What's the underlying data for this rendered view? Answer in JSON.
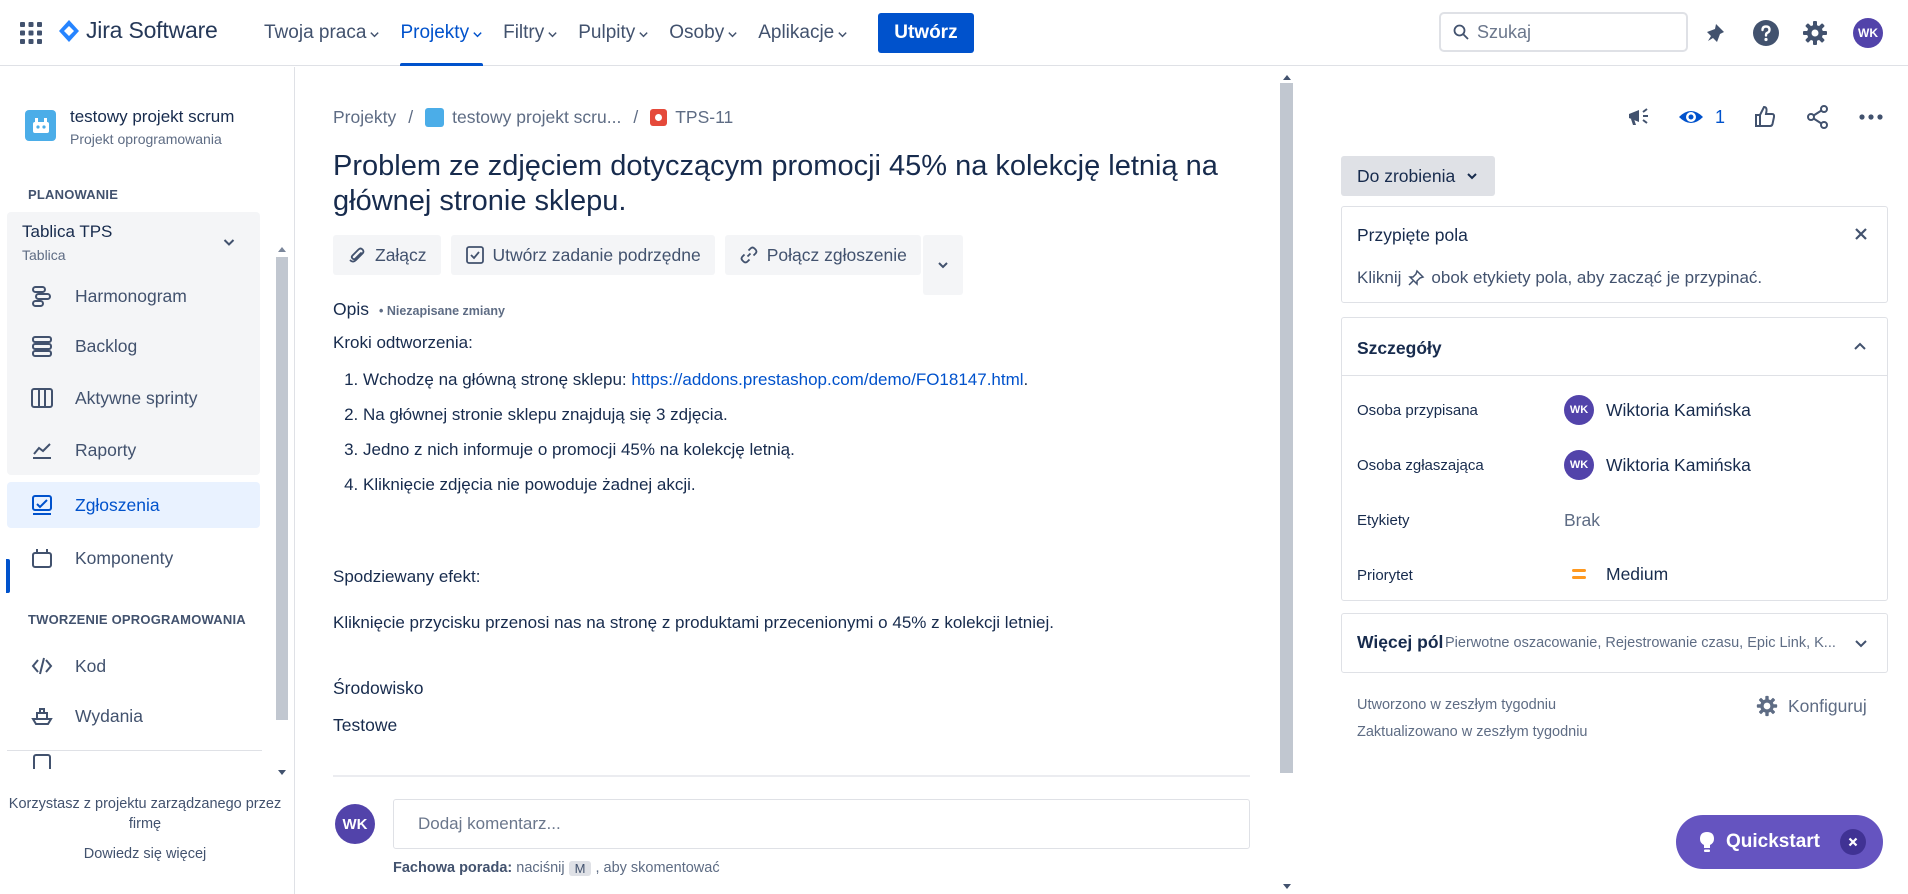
{
  "topbar": {
    "product_name": "Jira Software",
    "nav": [
      {
        "label": "Twoja praca"
      },
      {
        "label": "Projekty"
      },
      {
        "label": "Filtry"
      },
      {
        "label": "Pulpity"
      },
      {
        "label": "Osoby"
      },
      {
        "label": "Aplikacje"
      }
    ],
    "create_label": "Utwórz",
    "search_placeholder": "Szukaj",
    "user_initials": "WK",
    "accent": "#0052cc"
  },
  "sidebar": {
    "project_name": "testowy projekt scrum",
    "project_type": "Projekt oprogramowania",
    "section_planning": "PLANOWANIE",
    "board_title": "Tablica TPS",
    "board_sub": "Tablica",
    "items": [
      {
        "label": "Harmonogram",
        "icon": "timeline-icon"
      },
      {
        "label": "Backlog",
        "icon": "backlog-icon"
      },
      {
        "label": "Aktywne sprinty",
        "icon": "board-columns-icon"
      },
      {
        "label": "Raporty",
        "icon": "reports-icon"
      },
      {
        "label": "Zgłoszenia",
        "icon": "issues-icon"
      },
      {
        "label": "Komponenty",
        "icon": "components-icon"
      },
      {
        "label": "Kod",
        "icon": "code-icon"
      },
      {
        "label": "Wydania",
        "icon": "releases-icon"
      }
    ],
    "section_dev": "TWORZENIE OPROGRAMOWANIA",
    "footer_text": "Korzystasz z projektu zarządzanego przez firmę",
    "footer_link": "Dowiedz się więcej"
  },
  "issue": {
    "breadcrumb": {
      "root": "Projekty",
      "project": "testowy projekt scru...",
      "key": "TPS-11"
    },
    "title": "Problem ze zdjęciem dotyczącym promocji 45% na kolekcję letnią na głównej stronie sklepu.",
    "actions": {
      "attach": "Załącz",
      "subtask": "Utwórz zadanie podrzędne",
      "link": "Połącz zgłoszenie"
    },
    "description_label": "Opis",
    "unsaved_label": "• Niezapisane zmiany",
    "steps_heading": "Kroki odtworzenia:",
    "step1_prefix": "Wchodzę na główną stronę sklepu: ",
    "step1_link": "https://addons.prestashop.com/demo/FO18147.html",
    "step1_suffix": ".",
    "step2": "Na głównej stronie sklepu znajdują się 3 zdjęcia.",
    "step3": "Jedno z nich informuje o promocji 45% na kolekcję letnią.",
    "step4": "Kliknięcie zdjęcia nie powoduje żadnej akcji.",
    "expected_heading": "Spodziewany efekt:",
    "expected_text": "Kliknięcie przycisku przenosi nas na stronę z produktami przecenionymi o 45% z kolekcji letniej.",
    "environment_label": "Środowisko",
    "environment_value": "Testowe",
    "comment_placeholder": "Dodaj komentarz...",
    "tip_bold": "Fachowa porada:",
    "tip_text1": "naciśnij",
    "tip_key": "M",
    "tip_text2": ", aby skomentować"
  },
  "panel": {
    "watchers": "1",
    "status": "Do zrobienia",
    "pinned_title": "Przypięte pola",
    "pinned_text_1": "Kliknij",
    "pinned_text_2": "obok etykiety pola, aby zacząć je przypinać.",
    "details_title": "Szczegóły",
    "assignee_label": "Osoba przypisana",
    "assignee": "Wiktoria Kamińska",
    "reporter_label": "Osoba zgłaszająca",
    "reporter": "Wiktoria Kamińska",
    "labels_label": "Etykiety",
    "labels_value": "Brak",
    "priority_label": "Priorytet",
    "priority_value": "Medium",
    "priority_color": "#ff991f",
    "more_title": "Więcej pól",
    "more_sub": "Pierwotne oszacowanie, Rejestrowanie czasu, Epic Link, K...",
    "created": "Utworzono w zeszłym tygodniu",
    "updated": "Zaktualizowano w zeszłym tygodniu",
    "configure": "Konfiguruj",
    "quickstart": "Quickstart"
  }
}
